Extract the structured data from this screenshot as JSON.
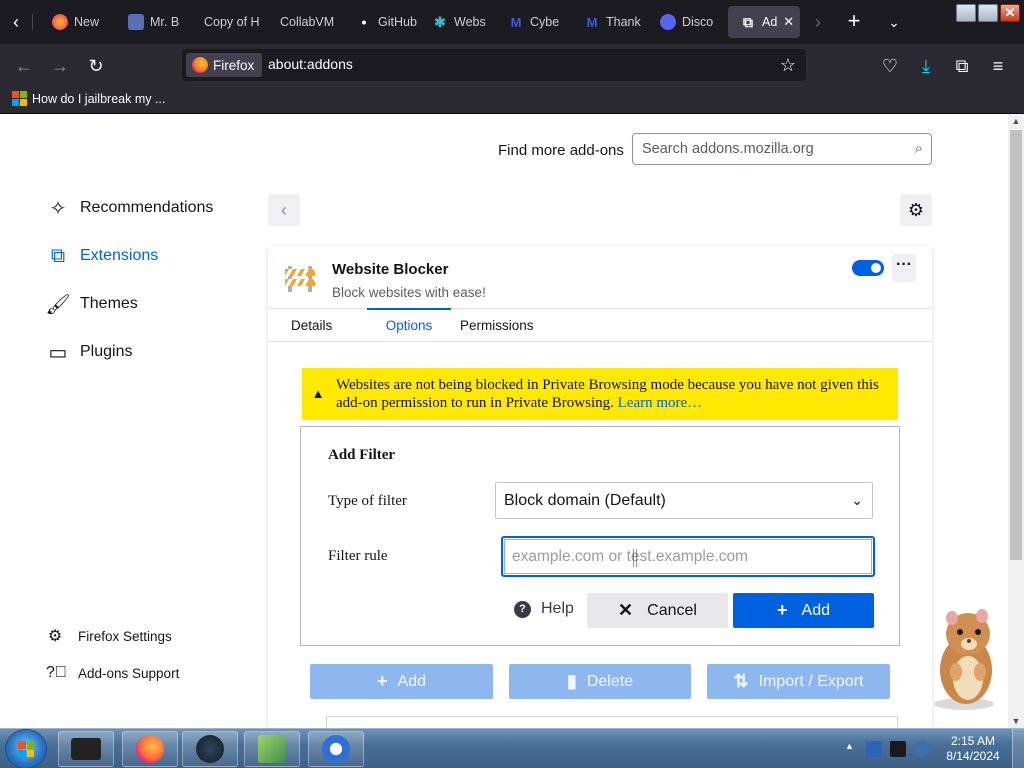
{
  "tabs": [
    {
      "title": "New",
      "favicon": "firefox-icon",
      "color": "#ff7139"
    },
    {
      "title": "Mr. B",
      "favicon": "avatar-icon",
      "color": "#5a6fb5"
    },
    {
      "title": "Copy of H",
      "favicon": "",
      "color": ""
    },
    {
      "title": "CollabVM",
      "favicon": "",
      "color": ""
    },
    {
      "title": "GitHub",
      "favicon": "github-icon",
      "color": "#ffffff"
    },
    {
      "title": "Webs",
      "favicon": "extension-icon",
      "color": "#3fb6c6"
    },
    {
      "title": "Cybe",
      "favicon": "m-icon",
      "color": "#3b5ce0"
    },
    {
      "title": "Thank",
      "favicon": "m-icon",
      "color": "#3b5ce0"
    },
    {
      "title": "Disco",
      "favicon": "discord-icon",
      "color": "#5865f2"
    },
    {
      "title": "Ad",
      "favicon": "puzzle-icon",
      "color": ""
    }
  ],
  "navbar": {
    "identity_label": "Firefox",
    "url": "about:addons"
  },
  "bookmarks": [
    {
      "label": "How do I jailbreak my ..."
    }
  ],
  "addons_page": {
    "find_more_label": "Find more add-ons",
    "search_placeholder": "Search addons.mozilla.org",
    "categories": [
      {
        "label": "Recommendations",
        "icon": "sparkle-icon",
        "selected": false
      },
      {
        "label": "Extensions",
        "icon": "puzzle-icon",
        "selected": true
      },
      {
        "label": "Themes",
        "icon": "paintbrush-icon",
        "selected": false
      },
      {
        "label": "Plugins",
        "icon": "plugin-icon",
        "selected": false
      }
    ],
    "footer_links": [
      {
        "label": "Firefox Settings",
        "icon": "gear-icon"
      },
      {
        "label": "Add-ons Support",
        "icon": "help-circle-icon"
      }
    ],
    "addon": {
      "name": "Website Blocker",
      "description": "Block websites with ease!",
      "enabled": true
    },
    "detail_tabs": [
      {
        "label": "Details",
        "active": false
      },
      {
        "label": "Options",
        "active": true
      },
      {
        "label": "Permissions",
        "active": false
      }
    ],
    "warning": {
      "text": "Websites are not being blocked in Private Browsing mode because you have not given this add-on permission to run in Private Browsing.",
      "link": "Learn more…"
    },
    "filter": {
      "title": "Add Filter",
      "type_label": "Type of filter",
      "type_value": "Block domain (Default)",
      "rule_label": "Filter rule",
      "rule_placeholder": "example.com or test.example.com",
      "help_label": "Help",
      "cancel_label": "Cancel",
      "add_label": "Add"
    },
    "action_bar": {
      "add_label": "Add",
      "delete_label": "Delete",
      "import_export_label": "Import / Export"
    }
  },
  "taskbar": {
    "time": "2:15 AM",
    "date": "8/14/2024"
  },
  "colors": {
    "accent": "#0061e0",
    "warning_bg": "#ffe900",
    "chrome_dark": "#1c1b22"
  }
}
